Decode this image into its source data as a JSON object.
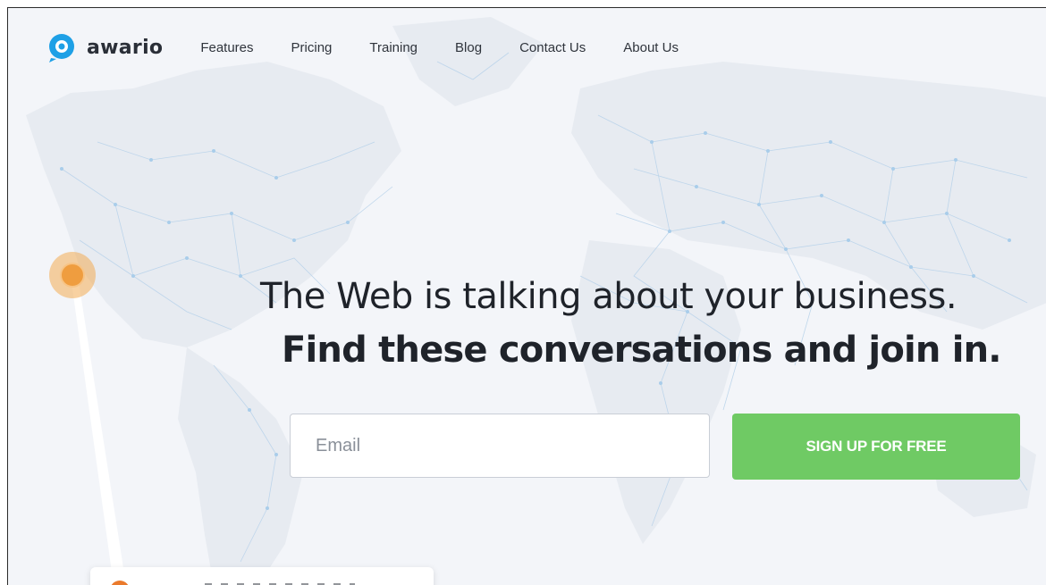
{
  "brand": {
    "name": "awario",
    "icon": "awario-logo-icon",
    "color": "#1ea0e6"
  },
  "nav": {
    "items": [
      {
        "label": "Features"
      },
      {
        "label": "Pricing"
      },
      {
        "label": "Training"
      },
      {
        "label": "Blog"
      },
      {
        "label": "Contact Us"
      },
      {
        "label": "About Us"
      }
    ]
  },
  "hero": {
    "headline": "The Web is talking about your business.",
    "subheadline": "Find these conversations and join in."
  },
  "signup": {
    "email_placeholder": "Email",
    "email_value": "",
    "button_label": "SIGN UP FOR FREE",
    "button_color": "#6fca64"
  },
  "map": {
    "background_color": "#f3f5f9",
    "network_color": "#a9cdea",
    "pin_color": "#ef9d3f"
  }
}
